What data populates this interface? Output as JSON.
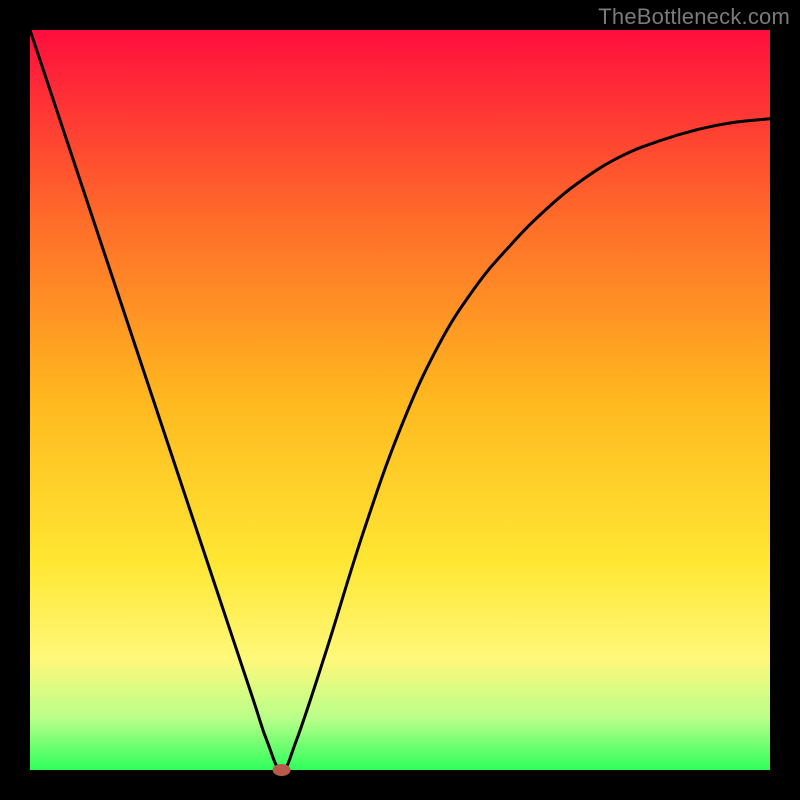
{
  "watermark": "TheBottleneck.com",
  "colors": {
    "black": "#000000",
    "gradient_top": "#ff0e3d",
    "gradient_upper_mid": "#ff6a2a",
    "gradient_mid": "#ffb81f",
    "gradient_lower_mid": "#ffe733",
    "gradient_yellow_band": "#fff87a",
    "gradient_pale_green": "#b9ff8a",
    "gradient_green": "#2fff5a",
    "curve_stroke": "#000000",
    "dot_fill": "#b85a4b"
  },
  "chart_data": {
    "type": "line",
    "title": "",
    "xlabel": "",
    "ylabel": "",
    "xlim": [
      0,
      100
    ],
    "ylim": [
      0,
      100
    ],
    "grid": false,
    "legend": false,
    "series": [
      {
        "name": "bottleneck-curve",
        "x": [
          0,
          5,
          10,
          15,
          20,
          25,
          30,
          32,
          34,
          36,
          40,
          45,
          50,
          55,
          60,
          65,
          70,
          75,
          80,
          85,
          90,
          95,
          100
        ],
        "y": [
          100,
          85,
          70,
          55,
          40,
          25,
          10,
          4,
          0,
          4,
          16,
          32,
          46,
          57,
          65,
          71,
          76,
          80,
          83,
          85,
          86.5,
          87.5,
          88
        ]
      }
    ],
    "markers": [
      {
        "name": "minimum-dot",
        "x": 34,
        "y": 0
      }
    ],
    "background_gradient": {
      "direction": "vertical",
      "stops": [
        {
          "offset": 0.0,
          "color": "#ff0e3d"
        },
        {
          "offset": 0.25,
          "color": "#ff6a2a"
        },
        {
          "offset": 0.5,
          "color": "#ffb81f"
        },
        {
          "offset": 0.72,
          "color": "#ffe733"
        },
        {
          "offset": 0.85,
          "color": "#fff87a"
        },
        {
          "offset": 0.93,
          "color": "#b9ff8a"
        },
        {
          "offset": 1.0,
          "color": "#2fff5a"
        }
      ]
    }
  }
}
